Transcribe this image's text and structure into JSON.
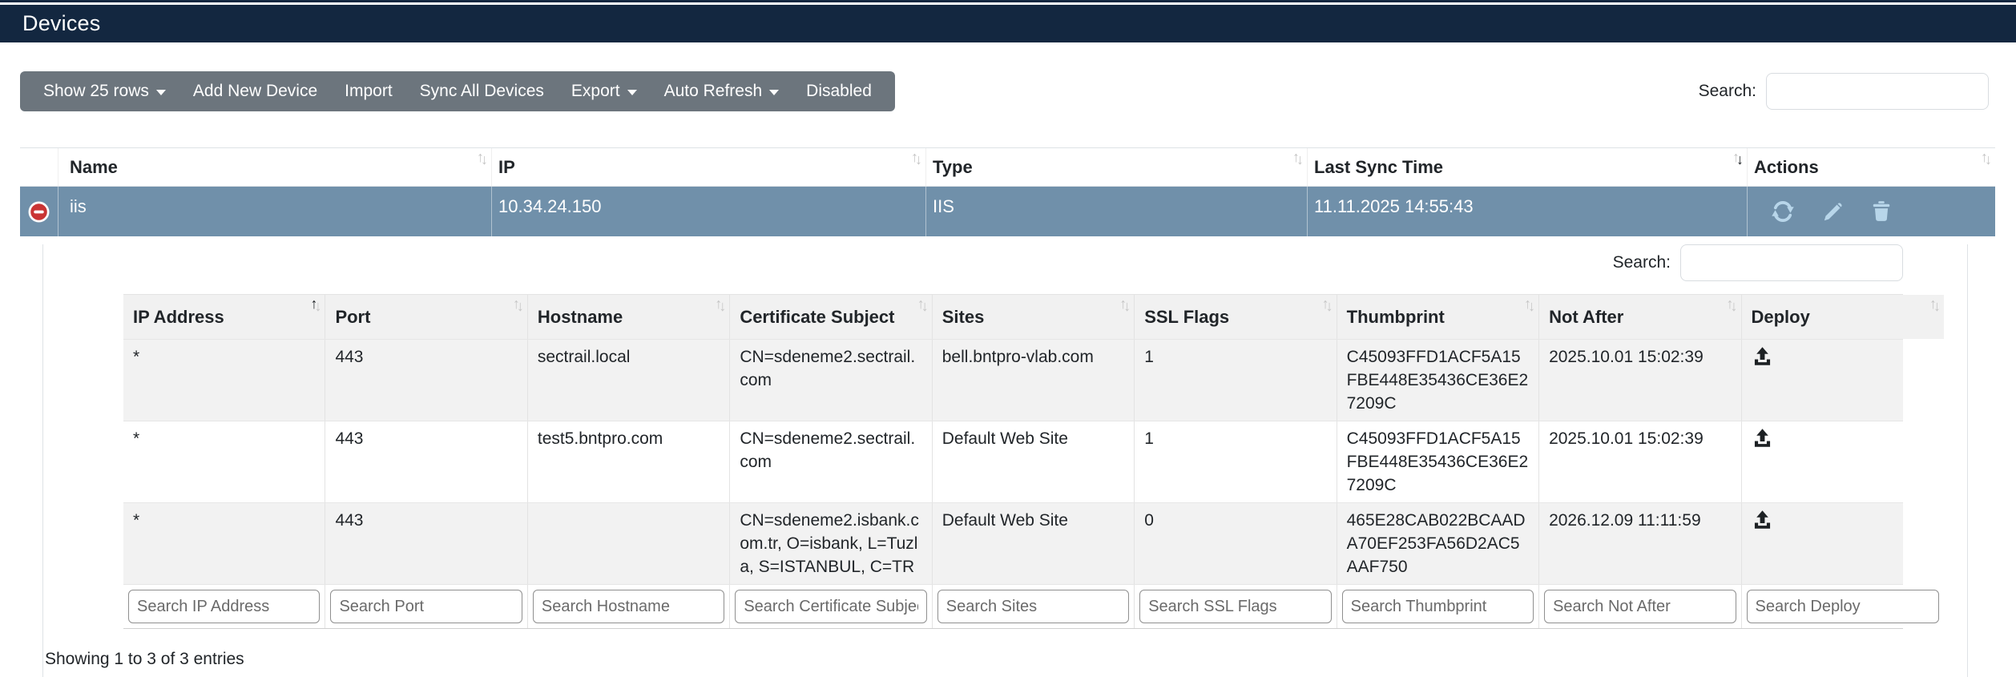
{
  "header": {
    "title": "Devices"
  },
  "toolbar": {
    "buttons": [
      {
        "label": "Show 25 rows",
        "dropdown": true
      },
      {
        "label": "Add New Device",
        "dropdown": false
      },
      {
        "label": "Import",
        "dropdown": false
      },
      {
        "label": "Sync All Devices",
        "dropdown": false
      },
      {
        "label": "Export",
        "dropdown": true
      },
      {
        "label": "Auto Refresh",
        "dropdown": true
      },
      {
        "label": "Disabled",
        "dropdown": false
      }
    ]
  },
  "search": {
    "label": "Search:",
    "value": ""
  },
  "devices_table": {
    "columns": [
      "Name",
      "IP",
      "Type",
      "Last Sync Time",
      "Actions"
    ],
    "sort": {
      "column": "Last Sync Time",
      "direction": "desc"
    },
    "row": {
      "name": "iis",
      "ip": "10.34.24.150",
      "type": "IIS",
      "last_sync_time": "11.11.2025 14:55:43"
    },
    "actions": [
      "sync",
      "edit",
      "delete"
    ]
  },
  "child": {
    "search": {
      "label": "Search:",
      "value": ""
    },
    "table": {
      "columns": [
        "IP Address",
        "Port",
        "Hostname",
        "Certificate Subject",
        "Sites",
        "SSL Flags",
        "Thumbprint",
        "Not After",
        "Deploy"
      ],
      "sort": {
        "column": "IP Address",
        "direction": "asc"
      },
      "rows": [
        {
          "ip_address": "*",
          "port": "443",
          "hostname": "sectrail.local",
          "certificate_subject": "CN=sdeneme2.sectrail.com",
          "sites": "bell.bntpro-vlab.com",
          "ssl_flags": "1",
          "thumbprint": "C45093FFD1ACF5A15FBE448E35436CE36E27209C",
          "not_after": "2025.10.01 15:02:39"
        },
        {
          "ip_address": "*",
          "port": "443",
          "hostname": "test5.bntpro.com",
          "certificate_subject": "CN=sdeneme2.sectrail.com",
          "sites": "Default Web Site",
          "ssl_flags": "1",
          "thumbprint": "C45093FFD1ACF5A15FBE448E35436CE36E27209C",
          "not_after": "2025.10.01 15:02:39"
        },
        {
          "ip_address": "*",
          "port": "443",
          "hostname": "",
          "certificate_subject": "CN=sdeneme2.isbank.com.tr, O=isbank, L=Tuzla, S=ISTANBUL, C=TR",
          "sites": "Default Web Site",
          "ssl_flags": "0",
          "thumbprint": "465E28CAB022BCAADA70EF253FA56D2AC5AAF750",
          "not_after": "2026.12.09 11:11:59"
        }
      ],
      "filters": [
        "Search IP Address",
        "Search Port",
        "Search Hostname",
        "Search Certificate Subject",
        "Search Sites",
        "Search SSL Flags",
        "Search Thumbprint",
        "Search Not After",
        "Search Deploy"
      ],
      "info": "Showing 1 to 3 of 3 entries"
    }
  },
  "icons": {
    "collapse-row-icon": "red circle with white minus",
    "sync-icon": "two circular arrows",
    "pencil-icon": "edit pencil",
    "trash-icon": "delete trash can",
    "upload-icon": "deploy upload arrow with tray",
    "sort-arrows-icon": "up/down arrow pair",
    "dropdown-caret-icon": "down triangle"
  },
  "colors": {
    "titlebar_bg": "#132740",
    "toolbar_bg": "#6c757d",
    "selected_row_bg": "#7090aa",
    "action_icon": "#b8d6ea",
    "expand_icon_red": "#c93434",
    "stripe_bg": "#f2f2f2",
    "border": "#dee2e6",
    "text": "#212529"
  }
}
